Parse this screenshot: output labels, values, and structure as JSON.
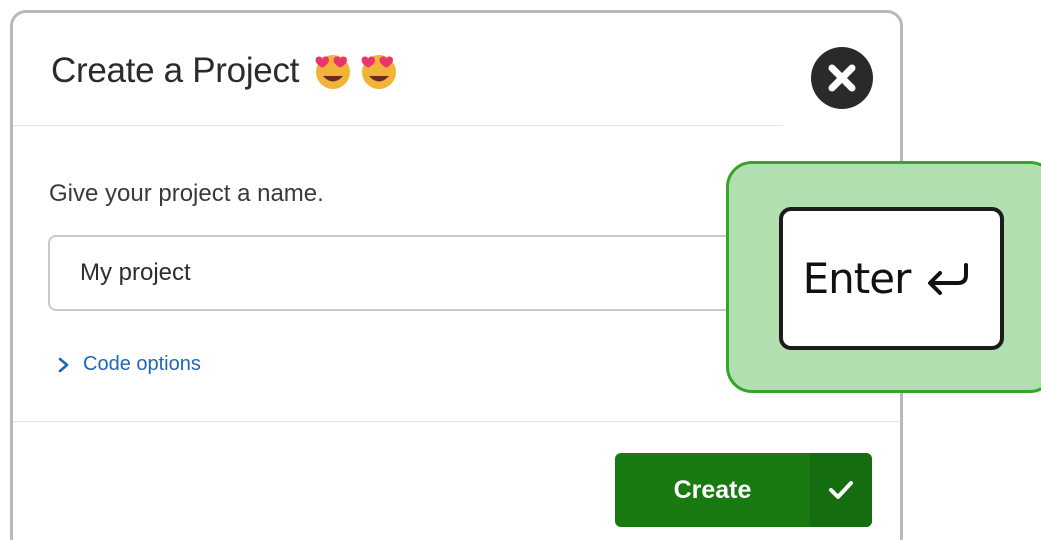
{
  "dialog": {
    "title": "Create a Project",
    "title_emojis": [
      "smiling-face-with-heart-eyes-icon",
      "smiling-face-with-heart-eyes-icon"
    ],
    "close_icon": "close-icon",
    "prompt": "Give your project a name.",
    "name_input": {
      "value": "My project"
    },
    "code_options_label": "Code options",
    "create_label": "Create",
    "create_icon": "checkmark-icon"
  },
  "keyboard_hint": {
    "key_label": "Enter",
    "key_icon": "return-arrow-icon"
  },
  "colors": {
    "create_button": "#1a7a12",
    "link": "#1f66b8",
    "callout_fill": "#b2dfb0",
    "callout_border": "#35a52a"
  }
}
